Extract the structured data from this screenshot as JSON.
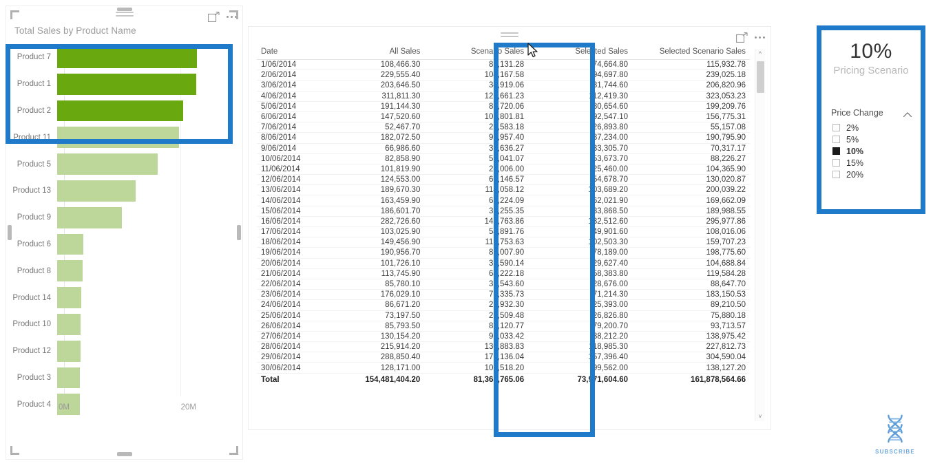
{
  "chart_visual": {
    "title": "Total Sales by Product Name",
    "focus_icon": "focus-mode-icon",
    "more_icon": "more-options-icon",
    "drag_icon": "drag-handle-icon",
    "axis_ticks": [
      "0M",
      "20M"
    ]
  },
  "chart_data": {
    "type": "bar",
    "orientation": "horizontal",
    "title": "Total Sales by Product Name",
    "xlabel": "",
    "ylabel": "",
    "xlim": [
      0,
      26
    ],
    "tick_values": [
      0,
      20
    ],
    "tick_labels": [
      "0M",
      "20M"
    ],
    "grid": true,
    "unit": "Millions",
    "highlight_color": "#6aa80f",
    "base_color": "#bdd69a",
    "categories": [
      "Product 7",
      "Product 1",
      "Product 2",
      "Product 11",
      "Product 5",
      "Product 13",
      "Product 9",
      "Product 6",
      "Product 8",
      "Product 14",
      "Product 10",
      "Product 12",
      "Product 3",
      "Product 4"
    ],
    "values": [
      22.5,
      22.4,
      20.2,
      19.6,
      16.2,
      12.6,
      10.4,
      4.2,
      4.1,
      3.9,
      3.8,
      3.8,
      3.7,
      3.6
    ],
    "highlighted": [
      "Product 7",
      "Product 1",
      "Product 2"
    ]
  },
  "table_visual": {
    "focus_icon": "focus-mode-icon",
    "more_icon": "more-options-icon",
    "drag_icon": "drag-handle-icon",
    "scroll_up_icon": "chevron-up-icon",
    "scroll_down_icon": "chevron-down-icon",
    "columns": [
      "Date",
      "All Sales",
      "Scenario Sales",
      "Selected Sales",
      "Selected Scenario Sales"
    ],
    "rows": [
      [
        "1/06/2014",
        "108,466.30",
        "82,131.28",
        "74,664.80",
        "115,932.78"
      ],
      [
        "2/06/2014",
        "229,555.40",
        "104,167.58",
        "94,697.80",
        "239,025.18"
      ],
      [
        "3/06/2014",
        "203,646.50",
        "34,919.06",
        "31,744.60",
        "206,820.96"
      ],
      [
        "4/06/2014",
        "311,811.30",
        "123,661.23",
        "112,419.30",
        "323,053.23"
      ],
      [
        "5/06/2014",
        "191,144.30",
        "88,720.06",
        "80,654.60",
        "199,209.76"
      ],
      [
        "6/06/2014",
        "147,520.60",
        "101,801.81",
        "92,547.10",
        "156,775.31"
      ],
      [
        "7/06/2014",
        "52,467.70",
        "29,583.18",
        "26,893.80",
        "55,157.08"
      ],
      [
        "8/06/2014",
        "182,072.50",
        "95,957.40",
        "87,234.00",
        "190,795.90"
      ],
      [
        "9/06/2014",
        "66,986.60",
        "36,636.27",
        "33,305.70",
        "70,317.17"
      ],
      [
        "10/06/2014",
        "82,858.90",
        "59,041.07",
        "53,673.70",
        "88,226.27"
      ],
      [
        "11/06/2014",
        "101,819.90",
        "28,006.00",
        "25,460.00",
        "104,365.90"
      ],
      [
        "12/06/2014",
        "124,553.00",
        "60,146.57",
        "54,678.70",
        "130,020.87"
      ],
      [
        "13/06/2014",
        "189,670.30",
        "114,058.12",
        "103,689.20",
        "200,039.22"
      ],
      [
        "14/06/2014",
        "163,459.90",
        "68,224.09",
        "62,021.90",
        "169,662.09"
      ],
      [
        "15/06/2014",
        "186,601.70",
        "37,255.35",
        "33,868.50",
        "189,988.55"
      ],
      [
        "16/06/2014",
        "282,726.60",
        "145,763.86",
        "132,512.60",
        "295,977.86"
      ],
      [
        "17/06/2014",
        "103,025.90",
        "54,891.76",
        "49,901.60",
        "108,016.06"
      ],
      [
        "18/06/2014",
        "149,456.90",
        "112,753.63",
        "102,503.30",
        "159,707.23"
      ],
      [
        "19/06/2014",
        "190,956.70",
        "86,007.90",
        "78,189.00",
        "198,775.60"
      ],
      [
        "20/06/2014",
        "101,726.10",
        "32,590.14",
        "29,627.40",
        "104,688.84"
      ],
      [
        "21/06/2014",
        "113,745.90",
        "64,222.18",
        "58,383.80",
        "119,584.28"
      ],
      [
        "22/06/2014",
        "85,780.10",
        "31,543.60",
        "28,676.00",
        "88,647.70"
      ],
      [
        "23/06/2014",
        "176,029.10",
        "78,335.73",
        "71,214.30",
        "183,150.53"
      ],
      [
        "24/06/2014",
        "86,671.20",
        "27,932.30",
        "25,393.00",
        "89,210.50"
      ],
      [
        "25/06/2014",
        "73,197.50",
        "29,509.48",
        "26,826.80",
        "75,880.18"
      ],
      [
        "26/06/2014",
        "85,793.50",
        "87,120.77",
        "79,200.70",
        "93,713.57"
      ],
      [
        "27/06/2014",
        "130,154.20",
        "97,033.42",
        "88,212.20",
        "138,975.42"
      ],
      [
        "28/06/2014",
        "215,914.20",
        "130,883.83",
        "118,985.30",
        "227,812.73"
      ],
      [
        "29/06/2014",
        "288,850.40",
        "173,136.04",
        "157,396.40",
        "304,590.04"
      ],
      [
        "30/06/2014",
        "128,171.00",
        "109,518.20",
        "99,562.00",
        "138,127.20"
      ]
    ],
    "total_row": [
      "Total",
      "154,481,404.20",
      "81,368,765.06",
      "73,971,604.60",
      "161,878,564.66"
    ]
  },
  "slicer_panel": {
    "card_value": "10%",
    "card_label": "Pricing Scenario",
    "slicer_title": "Price Change",
    "collapse_icon": "chevron-up-icon",
    "options": [
      {
        "label": "2%",
        "checked": false
      },
      {
        "label": "5%",
        "checked": false
      },
      {
        "label": "10%",
        "checked": true
      },
      {
        "label": "15%",
        "checked": false
      },
      {
        "label": "20%",
        "checked": false
      }
    ]
  },
  "watermark": {
    "text": "SUBSCRIBE",
    "logo_icon": "dna-helix-icon"
  },
  "colors": {
    "highlight_border": "#1f7ac9",
    "bar_dark": "#6aa80f",
    "bar_light": "#bdd69a",
    "watermark": "#6ea8dd"
  },
  "cursor": {
    "icon": "mouse-pointer-icon"
  }
}
